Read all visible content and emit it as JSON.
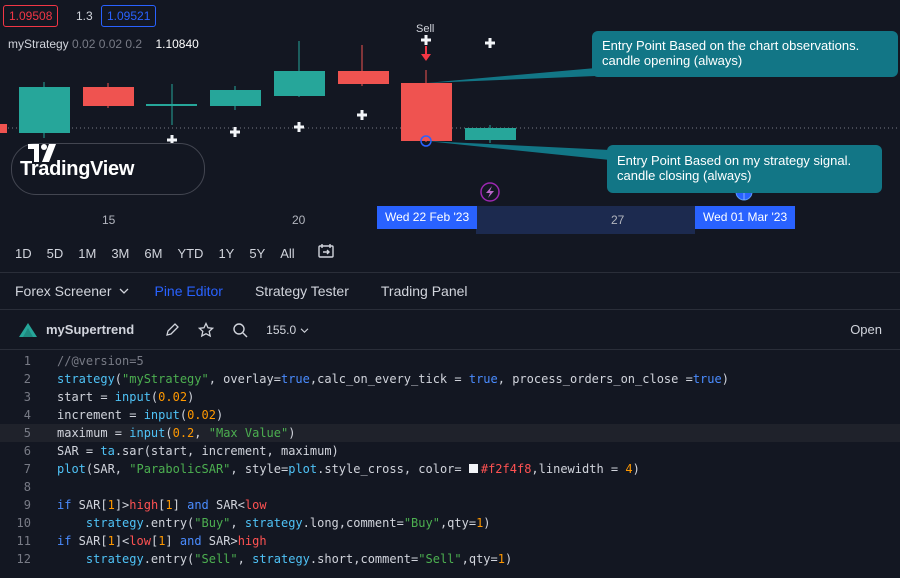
{
  "quote": {
    "bid": "1.09508",
    "spread": "1.3",
    "ask": "1.09521"
  },
  "legend": {
    "name": "myStrategy",
    "params": "0.02 0.02 0.2",
    "value": "1.10840"
  },
  "logo": {
    "wordmark": "TradingView"
  },
  "chart": {
    "sell_label": "Sell",
    "callout_open": {
      "line1": "Entry Point Based on the chart observations.",
      "line2": "candle opening (always)"
    },
    "callout_close": {
      "line1": "Entry Point Based on my strategy signal.",
      "line2": "candle closing (always)"
    },
    "colors": {
      "up": "#26a69a",
      "down": "#ef5350",
      "sar": "#f2f4f8",
      "callout": "#127686",
      "accent": "#2962ff"
    }
  },
  "timeaxis": {
    "ticks": [
      "15",
      "20",
      "27"
    ],
    "pill_left": "Wed 22 Feb '23",
    "pill_right": "Wed 01 Mar '23"
  },
  "ranges": [
    "1D",
    "5D",
    "1M",
    "3M",
    "6M",
    "YTD",
    "1Y",
    "5Y",
    "All"
  ],
  "panel_tabs": {
    "screener": "Forex Screener",
    "pine": "Pine Editor",
    "tester": "Strategy Tester",
    "trading": "Trading Panel"
  },
  "editor": {
    "script_name": "mySupertrend",
    "zoom": "155.0",
    "open_label": "Open"
  },
  "code_lines": [
    {
      "n": "1",
      "t": "//@version=5"
    },
    {
      "n": "2",
      "t": "strategy(\"myStrategy\", overlay=true,calc_on_every_tick = true, process_orders_on_close =true)"
    },
    {
      "n": "3",
      "t": "start = input(0.02)"
    },
    {
      "n": "4",
      "t": "increment = input(0.02)"
    },
    {
      "n": "5",
      "t": "maximum = input(0.2, \"Max Value\")"
    },
    {
      "n": "6",
      "t": "SAR = ta.sar(start, increment, maximum)"
    },
    {
      "n": "7",
      "t": "plot(SAR, \"ParabolicSAR\", style=plot.style_cross, color= #f2f4f8,linewidth = 4)"
    },
    {
      "n": "8",
      "t": ""
    },
    {
      "n": "9",
      "t": "if SAR[1]>high[1] and SAR<low"
    },
    {
      "n": "10",
      "t": "    strategy.entry(\"Buy\", strategy.long,comment=\"Buy\",qty=1)"
    },
    {
      "n": "11",
      "t": "if SAR[1]<low[1] and SAR>high"
    },
    {
      "n": "12",
      "t": "    strategy.entry(\"Sell\", strategy.short,comment=\"Sell\",qty=1)"
    }
  ]
}
